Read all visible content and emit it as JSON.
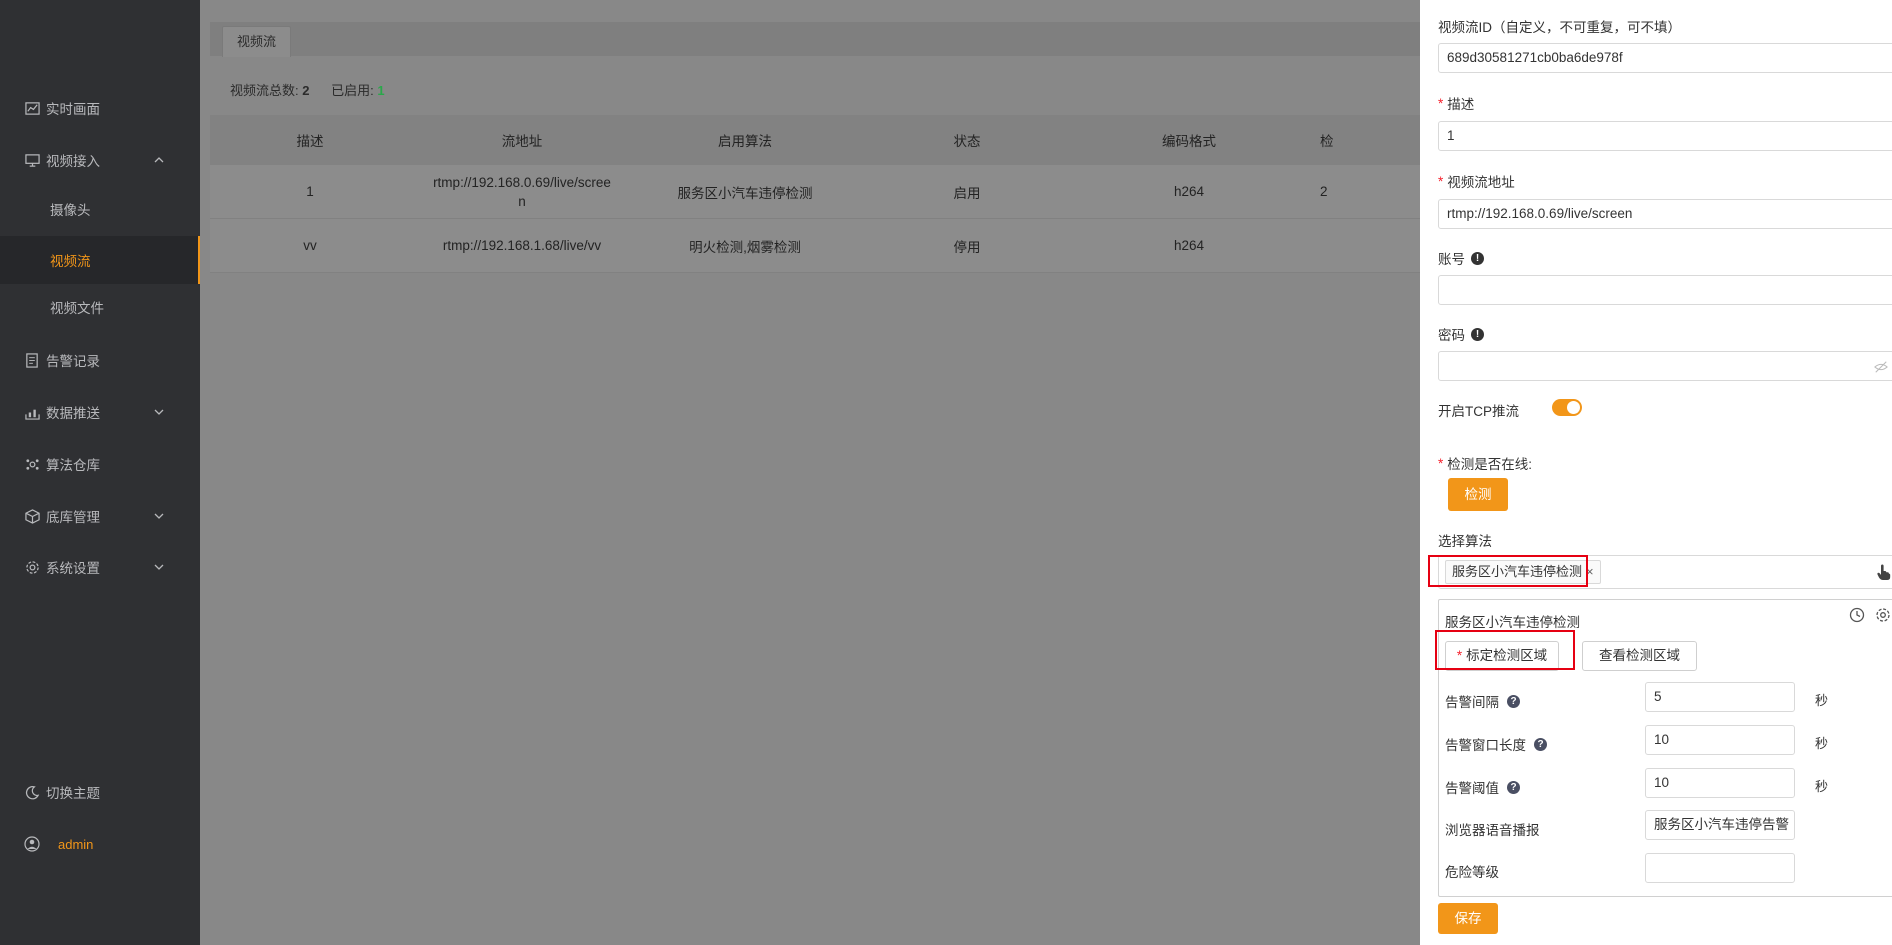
{
  "sidebar": {
    "items": [
      {
        "label": "实时画面",
        "icon": "chart-line-icon"
      },
      {
        "label": "视频接入",
        "icon": "monitor-icon"
      },
      {
        "label": "摄像头"
      },
      {
        "label": "视频流"
      },
      {
        "label": "视频文件"
      },
      {
        "label": "告警记录",
        "icon": "document-icon"
      },
      {
        "label": "数据推送",
        "icon": "upload-icon"
      },
      {
        "label": "算法仓库",
        "icon": "cube-network-icon"
      },
      {
        "label": "底库管理",
        "icon": "box-icon"
      },
      {
        "label": "系统设置",
        "icon": "gear-icon"
      }
    ],
    "theme_toggle": "切换主题",
    "user": "admin"
  },
  "main": {
    "tab": "视频流",
    "stats": {
      "total_label": "视频流总数:",
      "total": "2",
      "enabled_label": "已启用:",
      "enabled": "1"
    },
    "columns": [
      "描述",
      "流地址",
      "启用算法",
      "状态",
      "编码格式",
      "检"
    ],
    "rows": [
      {
        "desc": "1",
        "url_line1": "rtmp://192.168.0.69/live/scree",
        "url_line2": "n",
        "algos": "服务区小汽车违停检测",
        "status": "启用",
        "codec": "h264",
        "extra": "2"
      },
      {
        "desc": "vv",
        "url_line1": "rtmp://192.168.1.68/live/vv",
        "url_line2": "",
        "algos": "明火检测,烟雾检测",
        "status": "停用",
        "codec": "h264",
        "extra": ""
      }
    ]
  },
  "drawer": {
    "id_label": "视频流ID（自定义，不可重复，可不填）",
    "id_value": "689d30581271cb0ba6de978f",
    "desc_label": "描述",
    "desc_value": "1",
    "url_label": "视频流地址",
    "url_value": "rtmp://192.168.0.69/live/screen",
    "account_label": "账号",
    "account_value": "",
    "password_label": "密码",
    "password_value": "",
    "tcp_label": "开启TCP推流",
    "tcp_on": true,
    "online_label": "检测是否在线:",
    "detect_btn": "检测",
    "algo_label": "选择算法",
    "selected_tag": "服务区小汽车违停检测",
    "tag_close": "×",
    "panel": {
      "title": "服务区小汽车违停检测",
      "mark_btn": "标定检测区域",
      "view_btn": "查看检测区域",
      "interval_label": "告警间隔",
      "interval_value": "5",
      "window_label": "告警窗口长度",
      "window_value": "10",
      "threshold_label": "告警阈值",
      "threshold_value": "10",
      "unit": "秒",
      "voice_label": "浏览器语音播报",
      "voice_value": "服务区小汽车违停告警",
      "danger_label": "危险等级",
      "danger_value": ""
    },
    "save_btn": "保存"
  },
  "colors": {
    "accent": "#f29619",
    "highlight_box": "#e60012",
    "success": "#2aa84a"
  }
}
